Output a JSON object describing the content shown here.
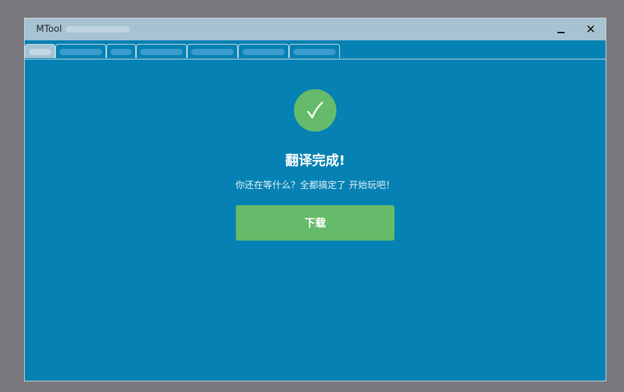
{
  "window": {
    "title": "MTool"
  },
  "tabs": [
    {
      "label": ""
    },
    {
      "label": ""
    },
    {
      "label": ""
    },
    {
      "label": ""
    },
    {
      "label": ""
    },
    {
      "label": ""
    },
    {
      "label": ""
    }
  ],
  "controls": {
    "minimize_icon": "minimize-icon",
    "close_icon": "close-icon",
    "close_glyph": "✕"
  },
  "result": {
    "icon": "check-icon",
    "title": "翻译完成!",
    "message": "你还在等什么？全都搞定了 开始玩吧！",
    "download_label": "下载"
  },
  "colors": {
    "background": "#0581b3",
    "titlebar": "#a7c3d2",
    "success": "#66bb6a"
  }
}
